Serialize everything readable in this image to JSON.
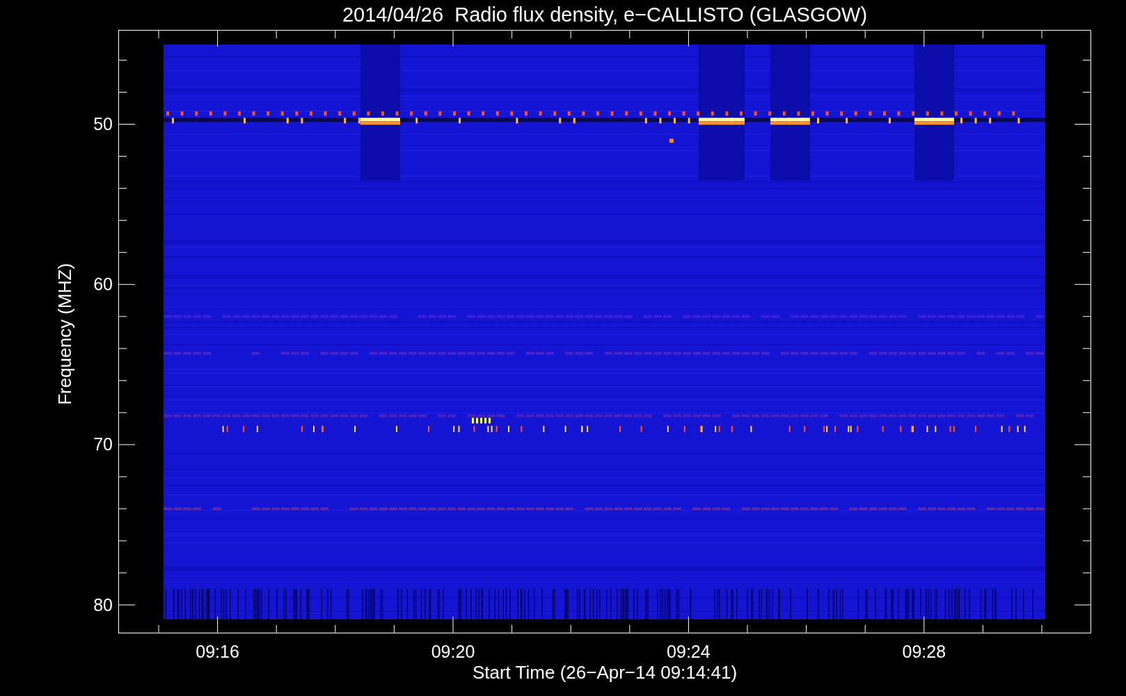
{
  "title": "2014/04/26  Radio flux density, e−CALLISTO (GLASGOW)",
  "y_axis": {
    "label": "Frequency (MHZ)",
    "ticks": [
      "50",
      "60",
      "70",
      "80"
    ]
  },
  "x_axis": {
    "label": "Start Time (26−Apr−14 09:14:41)",
    "ticks": [
      "09:16",
      "09:20",
      "09:24",
      "09:28"
    ]
  }
}
